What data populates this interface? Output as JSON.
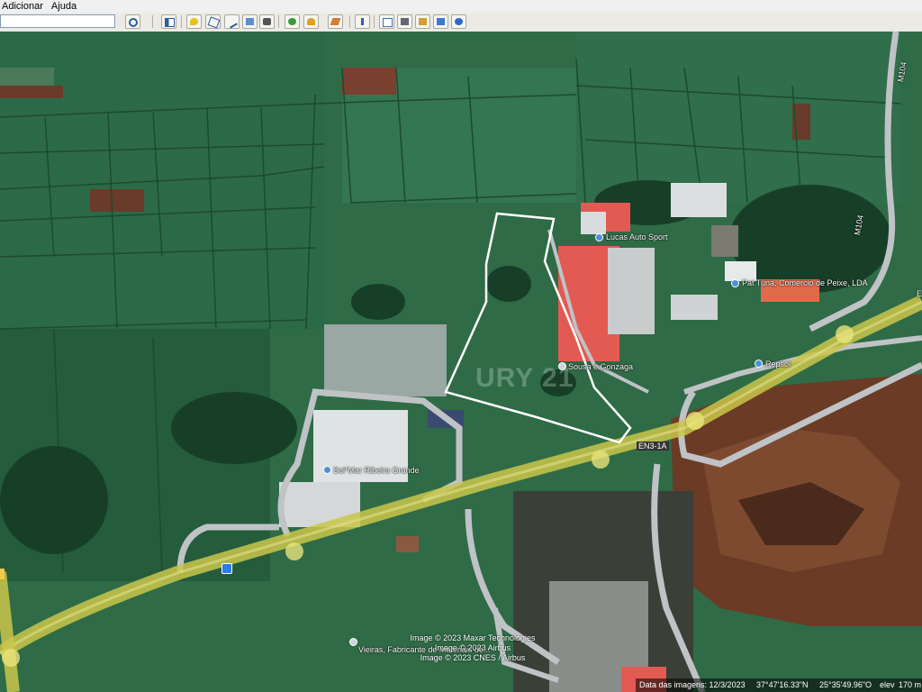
{
  "menubar": {
    "items": [
      {
        "label": "Adicionar",
        "underline": "A"
      },
      {
        "label": "Ajuda",
        "underline": "A"
      }
    ]
  },
  "toolbar": {
    "search_value": "",
    "buttons": [
      {
        "name": "search-icon"
      },
      {
        "name": "sidebar-toggle-icon"
      },
      {
        "name": "placemark-icon"
      },
      {
        "name": "polygon-icon"
      },
      {
        "name": "path-icon"
      },
      {
        "name": "image-overlay-icon"
      },
      {
        "name": "record-tour-icon"
      },
      {
        "name": "historical-imagery-icon"
      },
      {
        "name": "sunlight-icon"
      },
      {
        "name": "planets-icon"
      },
      {
        "name": "ruler-icon"
      },
      {
        "name": "email-icon"
      },
      {
        "name": "print-icon"
      },
      {
        "name": "save-image-icon"
      },
      {
        "name": "google-maps-icon"
      }
    ]
  },
  "map": {
    "labels": [
      {
        "name": "label-lucas-auto-sport",
        "text": "Lucas Auto Sport",
        "pin": true
      },
      {
        "name": "label-pat-tuna",
        "text": "Pat Tuna, Comercio de Peixe, LDA",
        "pin": true
      },
      {
        "name": "label-sousa-e-gonzaga",
        "text": "Sousa e Gonzaga",
        "pin": true
      },
      {
        "name": "label-repsol",
        "text": "Repsol",
        "pin": true
      },
      {
        "name": "label-solmar",
        "text": "Sol*Mar Ribeira Grande",
        "pin": true
      },
      {
        "name": "label-vieiras",
        "text": "Vieiras, Fabricante de Materiais de...",
        "pin": true
      },
      {
        "name": "label-road-m104",
        "text": "M104",
        "pin": false
      },
      {
        "name": "label-road-m104-top",
        "text": "M104",
        "pin": false
      },
      {
        "name": "label-road-e",
        "text": "E",
        "pin": false
      }
    ],
    "road_shield": "EN3-1A",
    "watermark": "URY 21",
    "credits": [
      "Image © 2023 Maxar Technologies",
      "Image © 2023 Airbus",
      "Image © 2023 CNES / Airbus"
    ],
    "colors": {
      "field_green": "#2f6b46",
      "dark_field": "#1f4a30",
      "highway": "#c9c54a",
      "road": "#bfc3c6",
      "red_roof": "#e35a52",
      "quarry": "#6b3b25",
      "boundary": "#ffffff"
    }
  },
  "statusbar": {
    "date_label": "Data das imagens: 12/3/2023",
    "lat": "37°47'16.33\"N",
    "lon": "25°35'49.96\"O",
    "elev": "elev",
    "alt": "170 m"
  }
}
